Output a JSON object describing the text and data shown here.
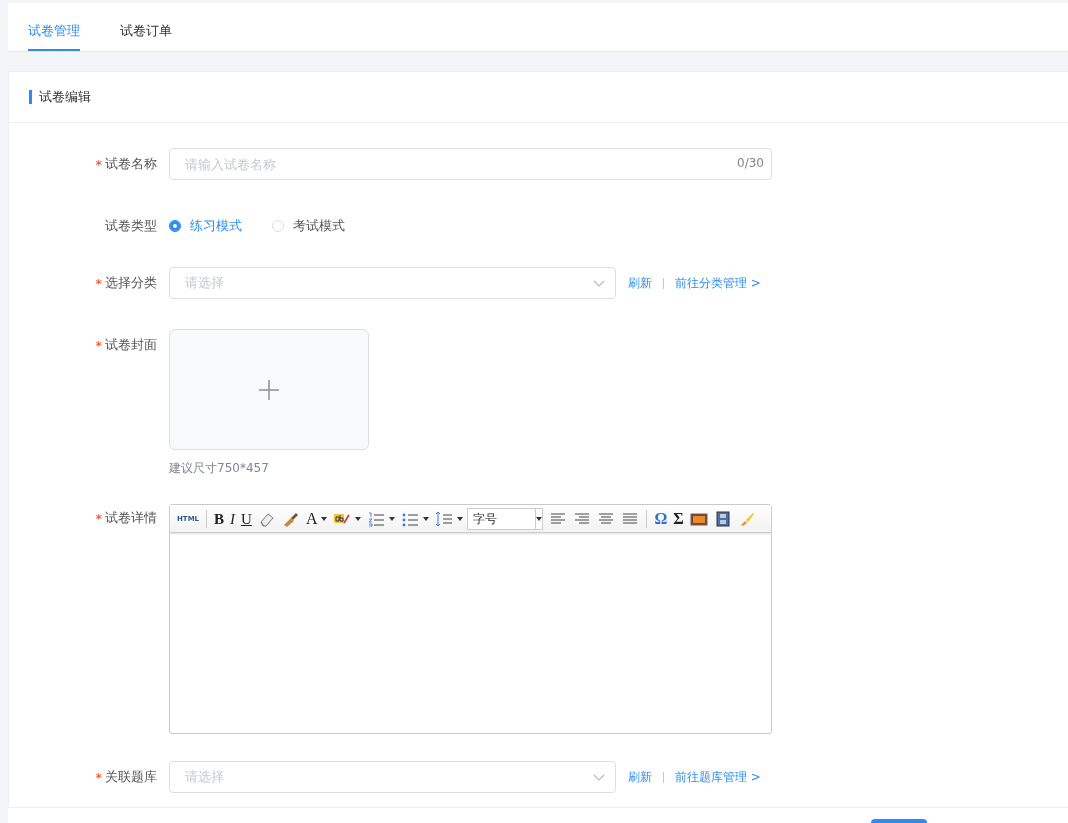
{
  "tabs": [
    {
      "label": "试卷管理",
      "selected": true
    },
    {
      "label": "试卷订单",
      "selected": false
    }
  ],
  "card": {
    "title": "试卷编辑"
  },
  "fields": [
    {
      "kind": "text",
      "label": "试卷名称",
      "required_mark": "*",
      "placeholder": "请输入试卷名称",
      "counter": "0/30"
    },
    {
      "kind": "radio",
      "label": "试卷类型",
      "options": [
        {
          "label": "练习模式",
          "selected": true
        },
        {
          "label": "考试模式",
          "selected": false
        }
      ]
    },
    {
      "kind": "select",
      "label": "选择分类",
      "required_mark": "*",
      "placeholder": "请选择",
      "links": [
        "刷新",
        "前往分类管理 >"
      ]
    },
    {
      "kind": "upload",
      "label": "试卷封面",
      "required_mark": "*",
      "hint": "建议尺寸750*457"
    },
    {
      "kind": "editor",
      "label": "试卷详情",
      "required_mark": "*",
      "toolbar": [
        {
          "kind": "glyph",
          "label": "HTML"
        },
        {
          "kind": "separator"
        },
        {
          "kind": "glyph",
          "label": "B"
        },
        {
          "kind": "glyph",
          "label": "I"
        },
        {
          "kind": "glyph",
          "label": "U"
        },
        {
          "kind": "icon"
        },
        {
          "kind": "icon"
        },
        {
          "kind": "glyph",
          "label": "A",
          "dropdown": true
        },
        {
          "kind": "icon",
          "dropdown": true
        },
        {
          "kind": "icon",
          "dropdown": true
        },
        {
          "kind": "icon",
          "dropdown": true
        },
        {
          "kind": "icon",
          "dropdown": true
        },
        {
          "kind": "select",
          "label": "字号"
        },
        {
          "kind": "icon"
        },
        {
          "kind": "icon"
        },
        {
          "kind": "icon"
        },
        {
          "kind": "icon"
        },
        {
          "kind": "separator"
        },
        {
          "kind": "glyph",
          "label": "Ω"
        },
        {
          "kind": "glyph",
          "label": "Σ"
        },
        {
          "kind": "icon"
        },
        {
          "kind": "icon"
        },
        {
          "kind": "icon"
        }
      ]
    },
    {
      "kind": "select",
      "label": "关联题库",
      "required_mark": "*",
      "placeholder": "请选择",
      "links": [
        "刷新",
        "前往题库管理 >"
      ]
    }
  ]
}
